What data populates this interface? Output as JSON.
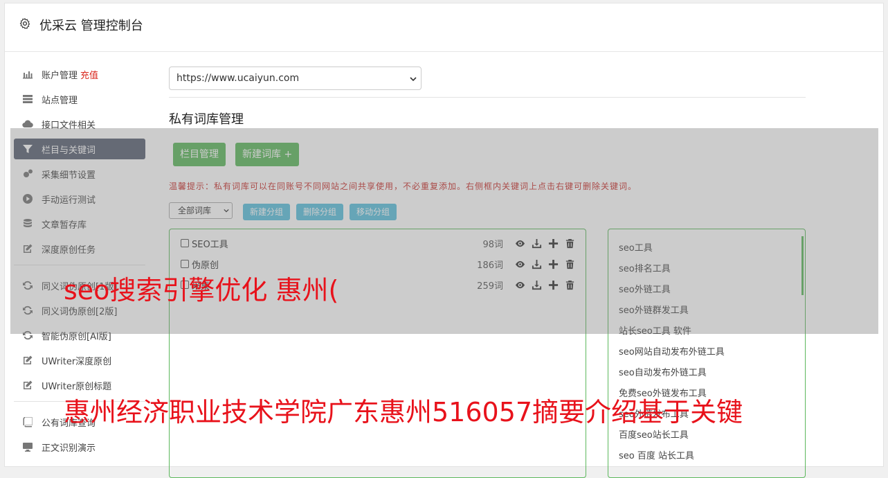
{
  "app": {
    "title": "优采云 管理控制台"
  },
  "sidebar": {
    "items": [
      {
        "label": "账户管理",
        "extra": "充值",
        "icon": "bar-chart-icon"
      },
      {
        "label": "站点管理",
        "icon": "server-icon"
      },
      {
        "label": "接口文件相关",
        "icon": "cloud-upload-icon"
      },
      {
        "label": "栏目与关键词",
        "icon": "filter-icon",
        "active": true
      },
      {
        "label": "采集细节设置",
        "icon": "cogs-icon"
      },
      {
        "label": "手动运行测试",
        "icon": "play-circle-icon"
      },
      {
        "label": "文章暂存库",
        "icon": "database-icon"
      },
      {
        "label": "深度原创任务",
        "icon": "edit-icon"
      },
      {
        "label": "同义词伪原创[1版]",
        "icon": "refresh-icon"
      },
      {
        "label": "同义词伪原创[2版]",
        "icon": "refresh-icon"
      },
      {
        "label": "智能伪原创[AI版]",
        "icon": "refresh-icon"
      },
      {
        "label": "UWriter深度原创",
        "icon": "edit-icon"
      },
      {
        "label": "UWriter原创标题",
        "icon": "edit-icon"
      },
      {
        "label": "公有词库查询",
        "icon": "book-icon"
      },
      {
        "label": "正文识别演示",
        "icon": "monitor-icon"
      }
    ]
  },
  "main": {
    "site_select": "https://www.ucaiyun.com",
    "section_title": "私有词库管理",
    "btn_columns": "栏目管理",
    "btn_new_lib": "新建词库 +",
    "tip": "温馨提示：私有词库可以在同账号不同网站之间共享使用，不必重复添加。右侧框内关键词上点击右键可删除关键词。",
    "group_select": "全部词库",
    "btn_new_group": "新建分组",
    "btn_delete_group": "删除分组",
    "btn_move_group": "移动分组",
    "libraries": [
      {
        "name": "SEO工具",
        "count": "98词"
      },
      {
        "name": "伪原创",
        "count": "186词"
      },
      {
        "name": "采集",
        "count": "259词"
      }
    ],
    "keywords": [
      "seo工具",
      "seo排名工具",
      "seo外链工具",
      "seo外链群发工具",
      "站长seo工具 软件",
      "seo网站自动发布外链工具",
      "seo自动发布外链工具",
      "免费seo外链发布工具",
      "seo外链发布工具",
      "百度seo站长工具",
      "seo 百度 站长工具"
    ]
  },
  "overlay_text": {
    "line1": "seo搜索引擎优化 惠州(",
    "line2": "惠州经济职业技术学院广东惠州516057摘要介绍基于关键"
  },
  "colors": {
    "green": "#5cb85c",
    "blue": "#5bc0de",
    "red": "#e8121b",
    "active_nav": "#5a6173"
  }
}
